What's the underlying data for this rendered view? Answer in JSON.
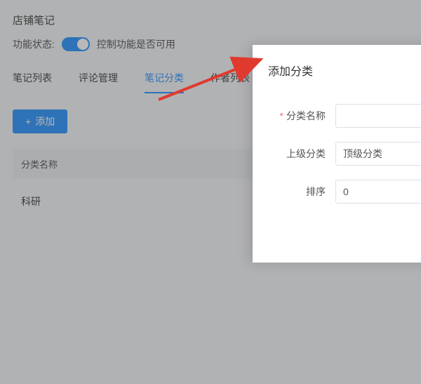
{
  "page": {
    "title": "店铺笔记",
    "feature_label": "功能状态:",
    "feature_hint": "控制功能是否可用"
  },
  "tabs": [
    {
      "label": "笔记列表"
    },
    {
      "label": "评论管理"
    },
    {
      "label": "笔记分类"
    },
    {
      "label": "作者列表"
    }
  ],
  "buttons": {
    "add": "添加"
  },
  "table": {
    "header": "分类名称",
    "rows": [
      {
        "name": "科研"
      }
    ]
  },
  "modal": {
    "title": "添加分类",
    "fields": {
      "name_label": "分类名称",
      "parent_label": "上级分类",
      "parent_value": "顶级分类",
      "sort_label": "排序",
      "sort_value": "0"
    }
  }
}
